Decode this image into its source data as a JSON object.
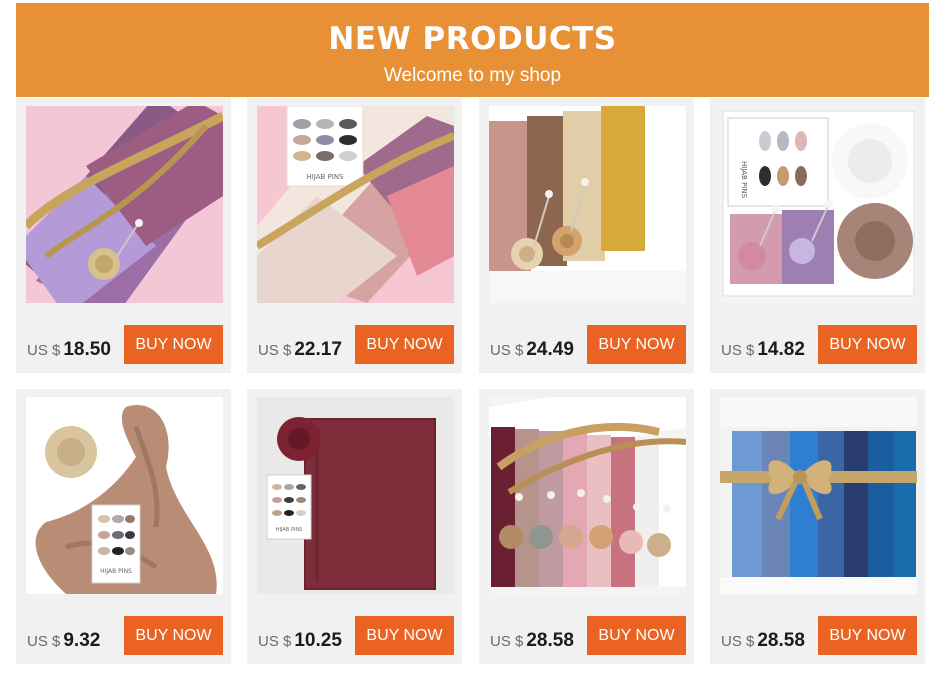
{
  "header": {
    "title": "NEW PRODUCTS",
    "subtitle": "Welcome to my shop"
  },
  "products": [
    {
      "currency": "US $",
      "price": "18.50",
      "button": "BUY NOW",
      "label": ""
    },
    {
      "currency": "US $",
      "price": "22.17",
      "button": "BUY NOW",
      "label": "HIJAB PINS"
    },
    {
      "currency": "US $",
      "price": "24.49",
      "button": "BUY NOW",
      "label": ""
    },
    {
      "currency": "US $",
      "price": "14.82",
      "button": "BUY NOW",
      "label": "HIJAB PINS"
    },
    {
      "currency": "US $",
      "price": "9.32",
      "button": "BUY NOW",
      "label": "HIJAB PINS"
    },
    {
      "currency": "US $",
      "price": "10.25",
      "button": "BUY NOW",
      "label": "HIJAB PINS"
    },
    {
      "currency": "US $",
      "price": "28.58",
      "button": "BUY NOW",
      "label": ""
    },
    {
      "currency": "US $",
      "price": "28.58",
      "button": "BUY NOW",
      "label": ""
    }
  ],
  "colors": {
    "banner": "#e89035",
    "button": "#ea6322"
  }
}
